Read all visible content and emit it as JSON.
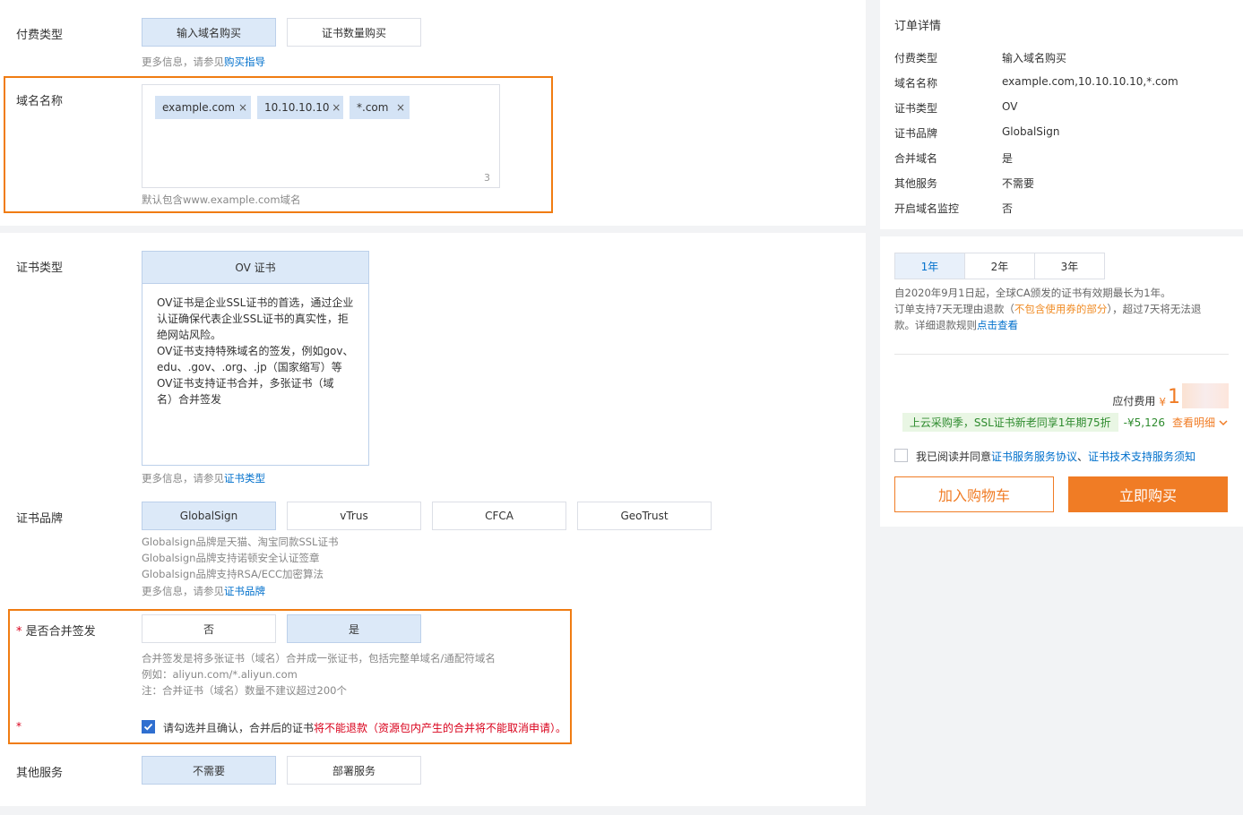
{
  "payment": {
    "label": "付费类型",
    "options": [
      "输入域名购买",
      "证书数量购买"
    ],
    "hint_prefix": "更多信息，请参见",
    "hint_link": "购买指导"
  },
  "domain": {
    "label": "域名名称",
    "tags": [
      "example.com",
      "10.10.10.10",
      "*.com"
    ],
    "remove_glyph": "×",
    "count": "3",
    "hint": "默认包含www.example.com域名"
  },
  "cert_type": {
    "label": "证书类型",
    "option": "OV 证书",
    "desc": [
      "OV证书是企业SSL证书的首选，通过企业",
      "认证确保代表企业SSL证书的真实性，拒",
      "绝网站风险。",
      "OV证书支持特殊域名的签发，例如gov、",
      "edu、.gov、.org、.jp（国家缩写）等",
      "OV证书支持证书合并，多张证书（域",
      "名）合并签发"
    ],
    "hint_prefix": "更多信息，请参见",
    "hint_link": "证书类型"
  },
  "brand": {
    "label": "证书品牌",
    "options": [
      "GlobalSign",
      "vTrus",
      "CFCA",
      "GeoTrust"
    ],
    "hints": [
      "Globalsign品牌是天猫、淘宝同款SSL证书",
      "Globalsign品牌支持诺顿安全认证签章",
      "Globalsign品牌支持RSA/ECC加密算法"
    ],
    "hint_prefix": "更多信息，请参见",
    "hint_link": "证书品牌"
  },
  "merge": {
    "required_mark": "*",
    "label": "是否合并签发",
    "options": [
      "否",
      "是"
    ],
    "hints": [
      "合并签发是将多张证书（域名）合并成一张证书，包括完整单域名/通配符域名",
      "例如：aliyun.com/*.aliyun.com",
      "注：合并证书（域名）数量不建议超过200个"
    ],
    "confirm_prefix": "请勾选并且确认，合并后的证书",
    "confirm_red": "将不能退款（资源包内产生的合并将不能取消申请）。"
  },
  "other": {
    "label": "其他服务",
    "options": [
      "不需要",
      "部署服务"
    ]
  },
  "order": {
    "title": "订单详情",
    "rows": [
      {
        "k": "付费类型",
        "v": "输入域名购买"
      },
      {
        "k": "域名名称",
        "v": "example.com,10.10.10.10,*.com"
      },
      {
        "k": "证书类型",
        "v": "OV"
      },
      {
        "k": "证书品牌",
        "v": "GlobalSign"
      },
      {
        "k": "合并域名",
        "v": "是"
      },
      {
        "k": "其他服务",
        "v": "不需要"
      },
      {
        "k": "开启域名监控",
        "v": "否"
      }
    ]
  },
  "purchase": {
    "years": [
      "1年",
      "2年",
      "3年"
    ],
    "note1": "自2020年9月1日起，全球CA颁发的证书有效期最长为1年。",
    "note2_a": "订单支持7天无理由退款（",
    "note2_b": "不包含使用券的部分",
    "note2_c": "），超过7天将无法退",
    "note3_a": "款。详细退款规则",
    "note3_link": "点击查看",
    "fee_label": "应付费用",
    "currency": "¥",
    "fee_value": "1",
    "promo": "上云采购季，SSL证书新老同享1年期75折",
    "discount": "-¥5,126",
    "detail": "查看明细",
    "agree_prefix": "我已阅读并同意",
    "agree_link1": "证书服务服务协议",
    "agree_sep": "、",
    "agree_link2": "证书技术支持服务须知",
    "cart_btn": "加入购物车",
    "buy_btn": "立即购买"
  },
  "colors": {
    "accent": "#0070cc",
    "selected_bg": "#dce9f8",
    "highlight_border": "#f07c12",
    "buy_orange": "#f07c25",
    "warning_red": "#d9001b",
    "promo_green": "#2e8b2e"
  }
}
